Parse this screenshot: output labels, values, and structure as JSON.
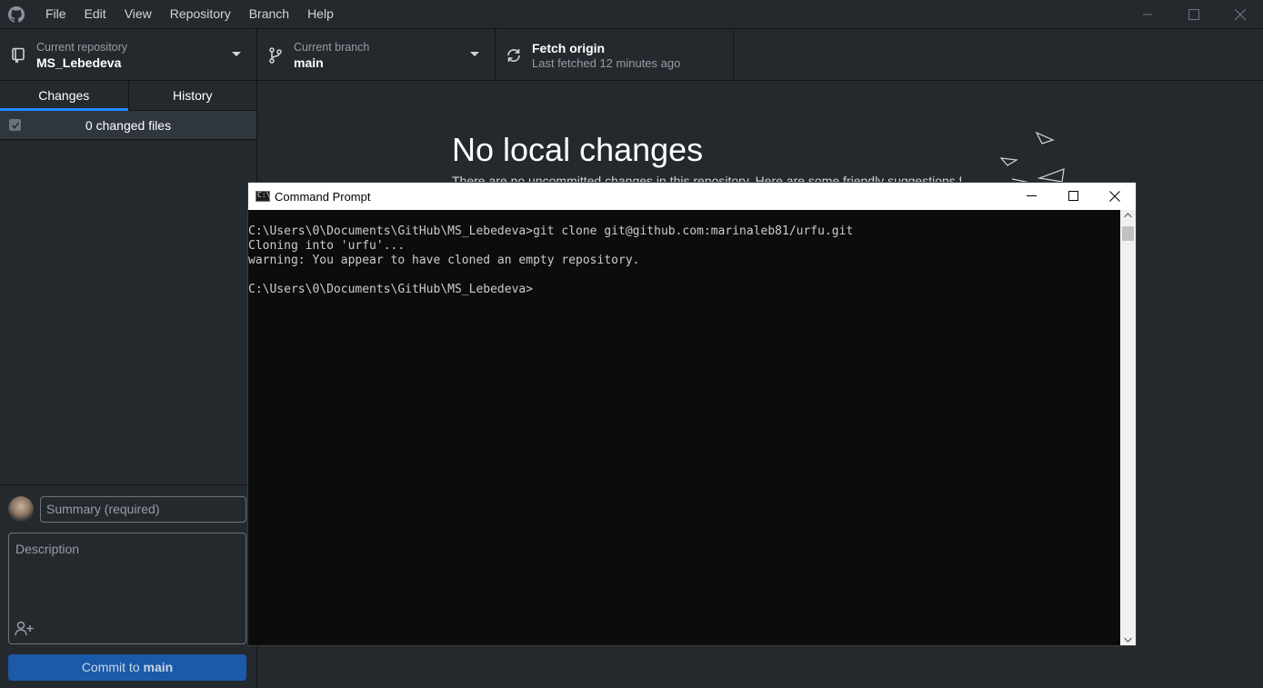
{
  "menu": [
    "File",
    "Edit",
    "View",
    "Repository",
    "Branch",
    "Help"
  ],
  "toolbar": {
    "repo_label": "Current repository",
    "repo_value": "MS_Lebedeva",
    "branch_label": "Current branch",
    "branch_value": "main",
    "fetch_label": "Fetch origin",
    "fetch_sub": "Last fetched 12 minutes ago"
  },
  "sidebar": {
    "tabs": [
      "Changes",
      "History"
    ],
    "changed_files": "0 changed files",
    "summary_placeholder": "Summary (required)",
    "description_placeholder": "Description",
    "commit_prefix": "Commit to ",
    "commit_branch": "main"
  },
  "main": {
    "heading": "No local changes",
    "subtext": "There are no uncommitted changes in this repository. Here are some friendly suggestions for"
  },
  "cmd": {
    "title": "Command Prompt",
    "lines": [
      "C:\\Users\\0\\Documents\\GitHub\\MS_Lebedeva>git clone git@github.com:marinaleb81/urfu.git",
      "Cloning into 'urfu'...",
      "warning: You appear to have cloned an empty repository.",
      "",
      "C:\\Users\\0\\Documents\\GitHub\\MS_Lebedeva>"
    ]
  },
  "colors": {
    "accent": "#2188ff",
    "commit_button": "#1b5aa8",
    "background": "#24292e",
    "terminal_bg": "#0c0c0c"
  }
}
